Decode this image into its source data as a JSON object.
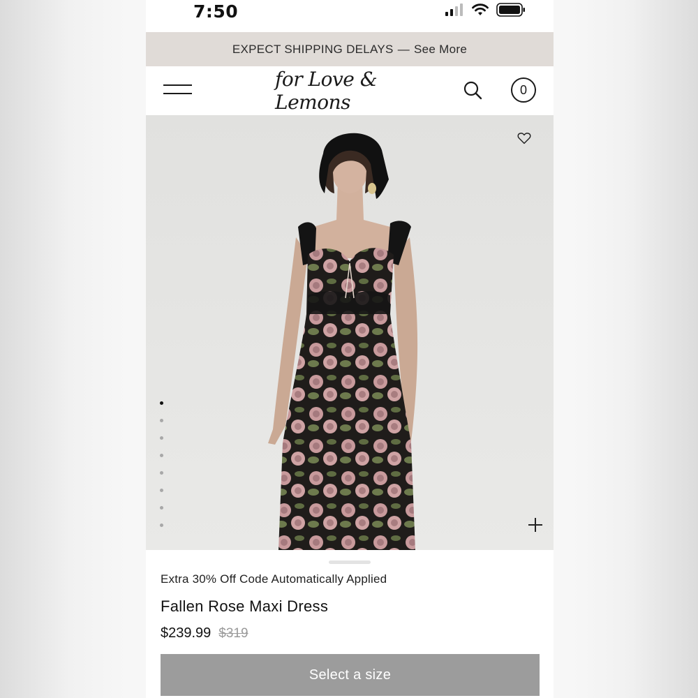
{
  "status_bar": {
    "time": "7:50",
    "icons": [
      "cellular-signal-icon",
      "wifi-icon",
      "battery-icon"
    ]
  },
  "banner": {
    "message": "EXPECT SHIPPING DELAYS",
    "separator": "—",
    "link_label": "See More"
  },
  "header": {
    "brand": "for Love & Lemons",
    "menu_icon": "hamburger-menu-icon",
    "search_icon": "search-icon",
    "cart_count": "0"
  },
  "gallery": {
    "wishlist_icon": "heart-icon",
    "zoom_icon": "plus-icon",
    "slide_count": 8,
    "active_slide": 1
  },
  "product": {
    "promo": "Extra 30% Off Code Automatically Applied",
    "title": "Fallen Rose Maxi Dress",
    "price": "$239.99",
    "original_price": "$319",
    "size_button_label": "Select a size"
  },
  "colors": {
    "banner_bg": "#e0dbd7",
    "button_bg": "#9c9c9c",
    "dress_base": "#1f1c1a",
    "rose_pink": "#c89a9c",
    "leaf_green": "#6d7a4d"
  }
}
